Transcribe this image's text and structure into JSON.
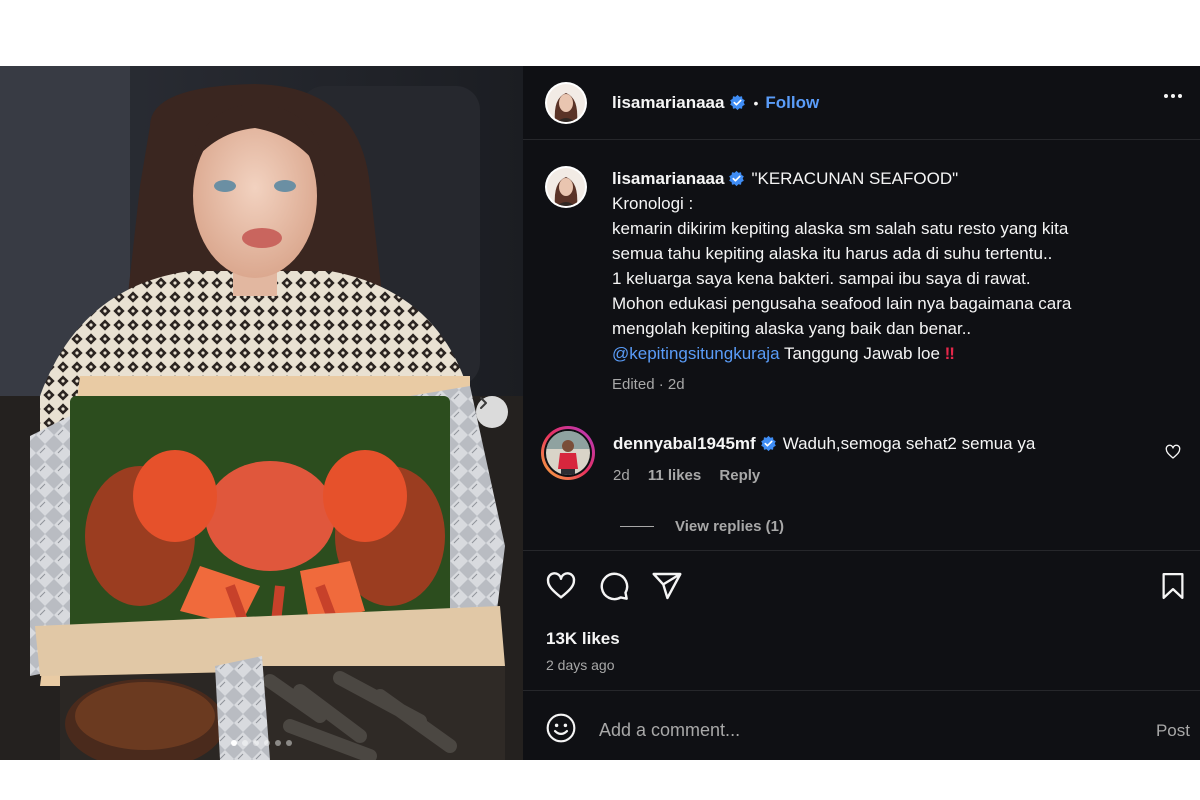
{
  "post": {
    "username": "lisamarianaaa",
    "follow_label": "Follow",
    "separator": "•",
    "more_icon": "more-horizontal-icon",
    "caption": {
      "title": "\"KERACUNAN SEAFOOD\"",
      "lines": [
        "Kronologi :",
        "kemarin dikirim kepiting alaska sm salah satu resto yang kita",
        "semua tahu kepiting alaska itu harus ada di suhu tertentu..",
        "1 keluarga saya kena bakteri. sampai ibu saya di rawat.",
        "Mohon edukasi pengusaha seafood lain nya bagaimana cara",
        "mengolah kepiting alaska yang baik dan benar.."
      ],
      "mention": "@kepitingsitungkuraja",
      "closing": "Tanggung Jawab loe",
      "closing_mark": "‼",
      "edited": "Edited",
      "dot": "·",
      "age": "2d"
    },
    "comment": {
      "username": "dennyabal1945mf",
      "text": "Waduh,semoga sehat2 semua ya",
      "age": "2d",
      "likes": "11 likes",
      "reply_label": "Reply"
    },
    "view_replies": "View replies (1)",
    "likes": "13K likes",
    "posted": "2 days ago",
    "comment_placeholder": "Add a comment...",
    "post_label": "Post",
    "carousel": {
      "slides": 6,
      "active_index": 0
    }
  },
  "colors": {
    "panel_bg": "#0f1014",
    "link": "#5a9cf8",
    "muted": "#a8a8a8",
    "verified": "#3f8df5",
    "alert": "#e5274a"
  }
}
